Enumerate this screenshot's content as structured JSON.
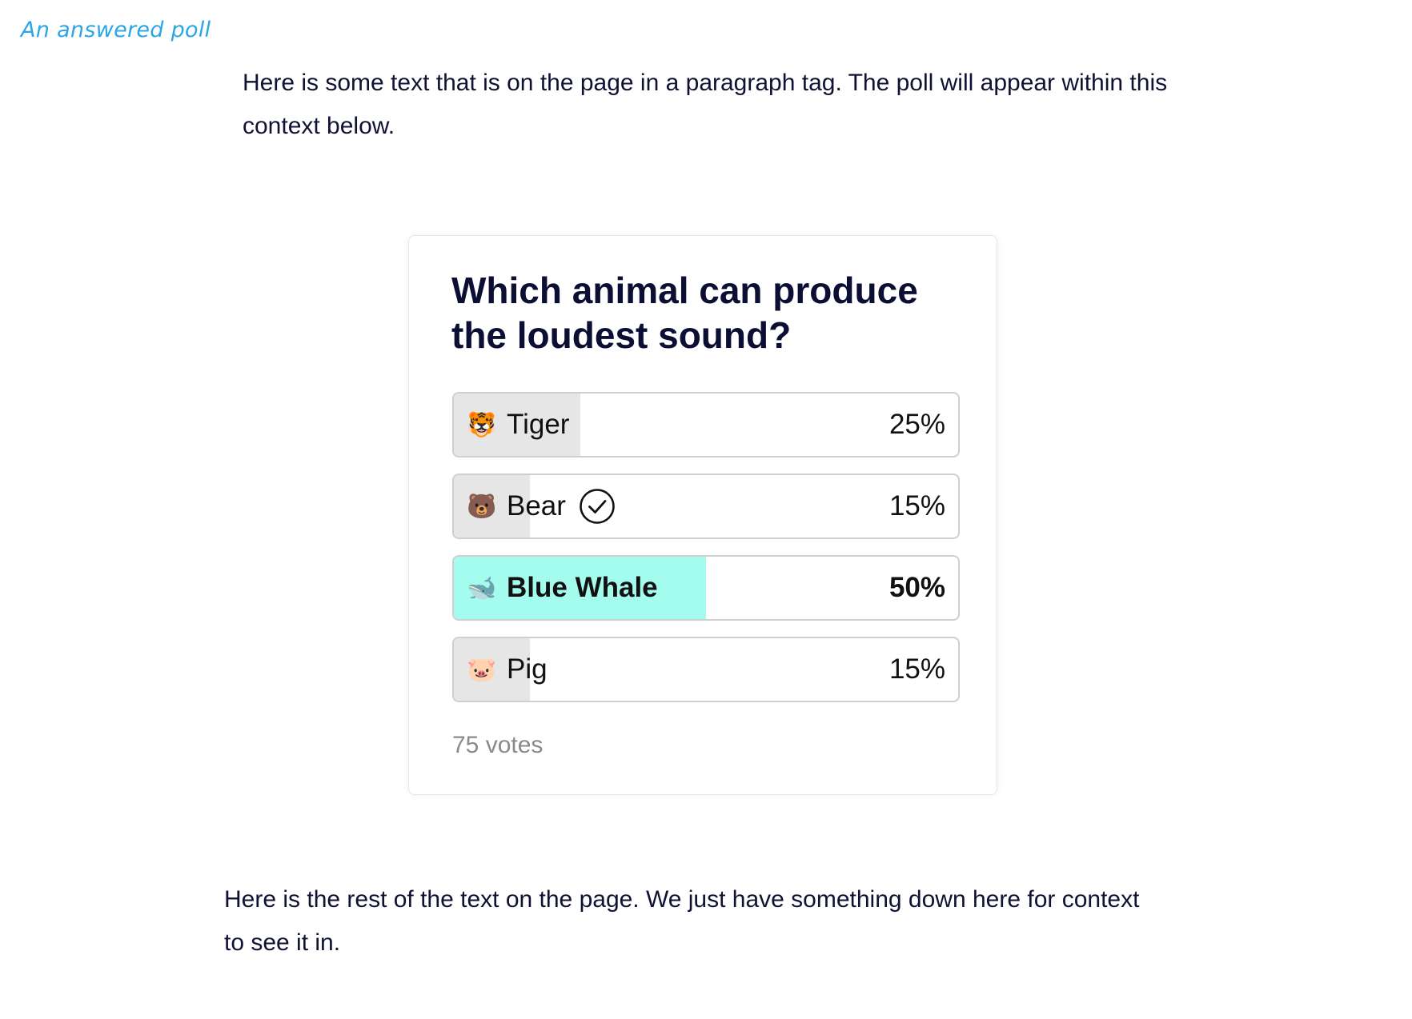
{
  "annotation": "An answered poll",
  "intro_text": "Here is some text that is on the page in a paragraph tag. The poll will appear within this context below.",
  "outro_text": "Here is the rest of the text on the page. We just have something down here for context to see it in.",
  "poll": {
    "question": "Which animal can produce the loudest sound?",
    "options": [
      {
        "emoji": "🐯",
        "icon": "tiger-face",
        "label": "Tiger",
        "percent_label": "25%",
        "percent": 25,
        "selected": false,
        "winner": false
      },
      {
        "emoji": "🐻",
        "icon": "bear-face",
        "label": "Bear",
        "percent_label": "15%",
        "percent": 15,
        "selected": true,
        "winner": false
      },
      {
        "emoji": "🐋",
        "icon": "whale",
        "label": "Blue Whale",
        "percent_label": "50%",
        "percent": 50,
        "selected": false,
        "winner": true
      },
      {
        "emoji": "🐷",
        "icon": "pig-face",
        "label": "Pig",
        "percent_label": "15%",
        "percent": 15,
        "selected": false,
        "winner": false
      }
    ],
    "votes_label": "75 votes"
  },
  "colors": {
    "text": "#0f1233",
    "annotation": "#2aa6e6",
    "bar_default": "#e6e6e6",
    "bar_winner": "#a3fcee",
    "border": "#cfcfcf",
    "votes": "#8a8a8a"
  }
}
